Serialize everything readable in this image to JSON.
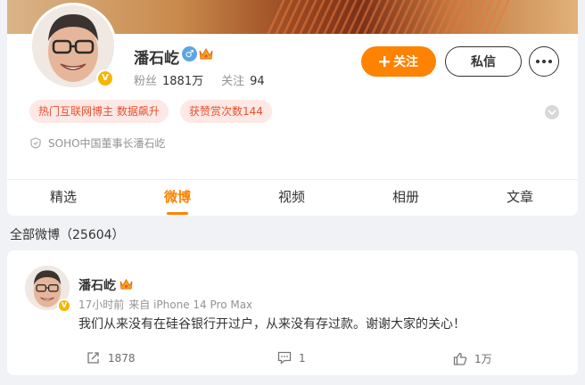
{
  "profile": {
    "name": "潘石屹",
    "fans_label": "粉丝",
    "fans_count": "1881万",
    "following_label": "关注",
    "following_count": "94",
    "follow_button": "关注",
    "message_button": "私信",
    "tags": [
      "热门互联网博主 数据飙升",
      "获赞赏次数144"
    ],
    "bio": "SOHO中国董事长潘石屹",
    "verified_badge": "V"
  },
  "tabs": [
    "精选",
    "微博",
    "视频",
    "相册",
    "文章"
  ],
  "active_tab": "微博",
  "feed": {
    "all_label": "全部微博（25604）"
  },
  "post": {
    "author": "潘石屹",
    "time": "17小时前",
    "source": "来自 iPhone 14 Pro Max",
    "text": "我们从来没有在硅谷银行开过户，从来没有存过款。谢谢大家的关心！",
    "reposts": "1878",
    "comments": "1",
    "likes": "1万"
  },
  "colors": {
    "accent": "#ff8200",
    "tag_bg": "#fde8e5",
    "tag_text": "#e5512e",
    "verified": "#f7b500",
    "male_badge": "#5ca6e6"
  },
  "icons": [
    "verified-v-icon",
    "male-icon",
    "crown-icon",
    "plus-icon",
    "more-icon",
    "chevron-down-icon",
    "shield-icon",
    "repost-icon",
    "comment-icon",
    "like-icon"
  ]
}
